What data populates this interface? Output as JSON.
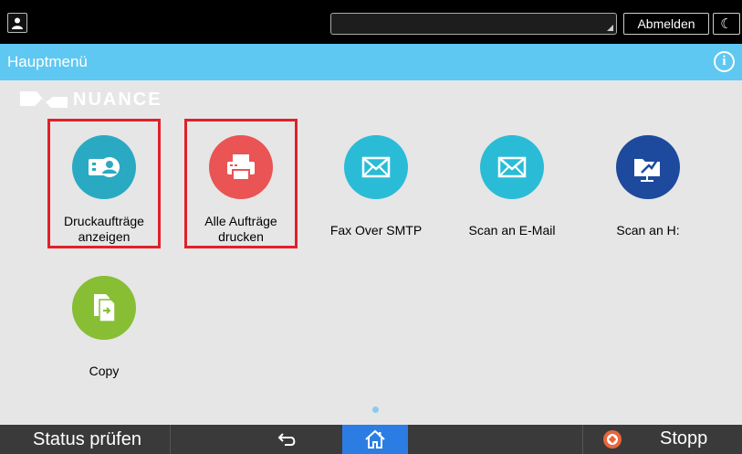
{
  "topbar": {
    "user_icon": "user-icon",
    "logout_label": "Abmelden",
    "sleep_icon": "crescent-moon-icon",
    "sleep_glyph": "☾"
  },
  "header": {
    "title": "Hauptmenü",
    "info_icon": "info-icon",
    "info_glyph": "i"
  },
  "logo": {
    "text": "NUANCE"
  },
  "apps": [
    {
      "label_line1": "Druckaufträge",
      "label_line2": "anzeigen",
      "icon": "print-jobs-icon",
      "color": "#2aaac2",
      "highlighted": true
    },
    {
      "label_line1": "Alle Aufträge",
      "label_line2": "drucken",
      "icon": "printer-icon",
      "color": "#ea5454",
      "highlighted": true
    },
    {
      "label_line1": "Fax Over SMTP",
      "label_line2": "",
      "icon": "envelope-icon",
      "color": "#2abcd7",
      "highlighted": false
    },
    {
      "label_line1": "Scan an E-Mail",
      "label_line2": "",
      "icon": "envelope-icon",
      "color": "#2abcd7",
      "highlighted": false
    },
    {
      "label_line1": "Scan an H:",
      "label_line2": "",
      "icon": "folder-scan-icon",
      "color": "#1d4a9c",
      "highlighted": false
    },
    {
      "label_line1": "Copy",
      "label_line2": "",
      "icon": "copy-icon",
      "color": "#87be34",
      "highlighted": false
    }
  ],
  "pager": {
    "pages": 1,
    "current": 1
  },
  "bottombar": {
    "status_label": "Status prüfen",
    "back_icon": "back-arrow-icon",
    "home_icon": "home-icon",
    "stop_icon": "stop-icon",
    "stop_label": "Stopp"
  },
  "colors": {
    "header": "#5ec8f2",
    "highlight": "#e0202a",
    "home_active": "#2c7de3",
    "stop": "#e8663c"
  }
}
